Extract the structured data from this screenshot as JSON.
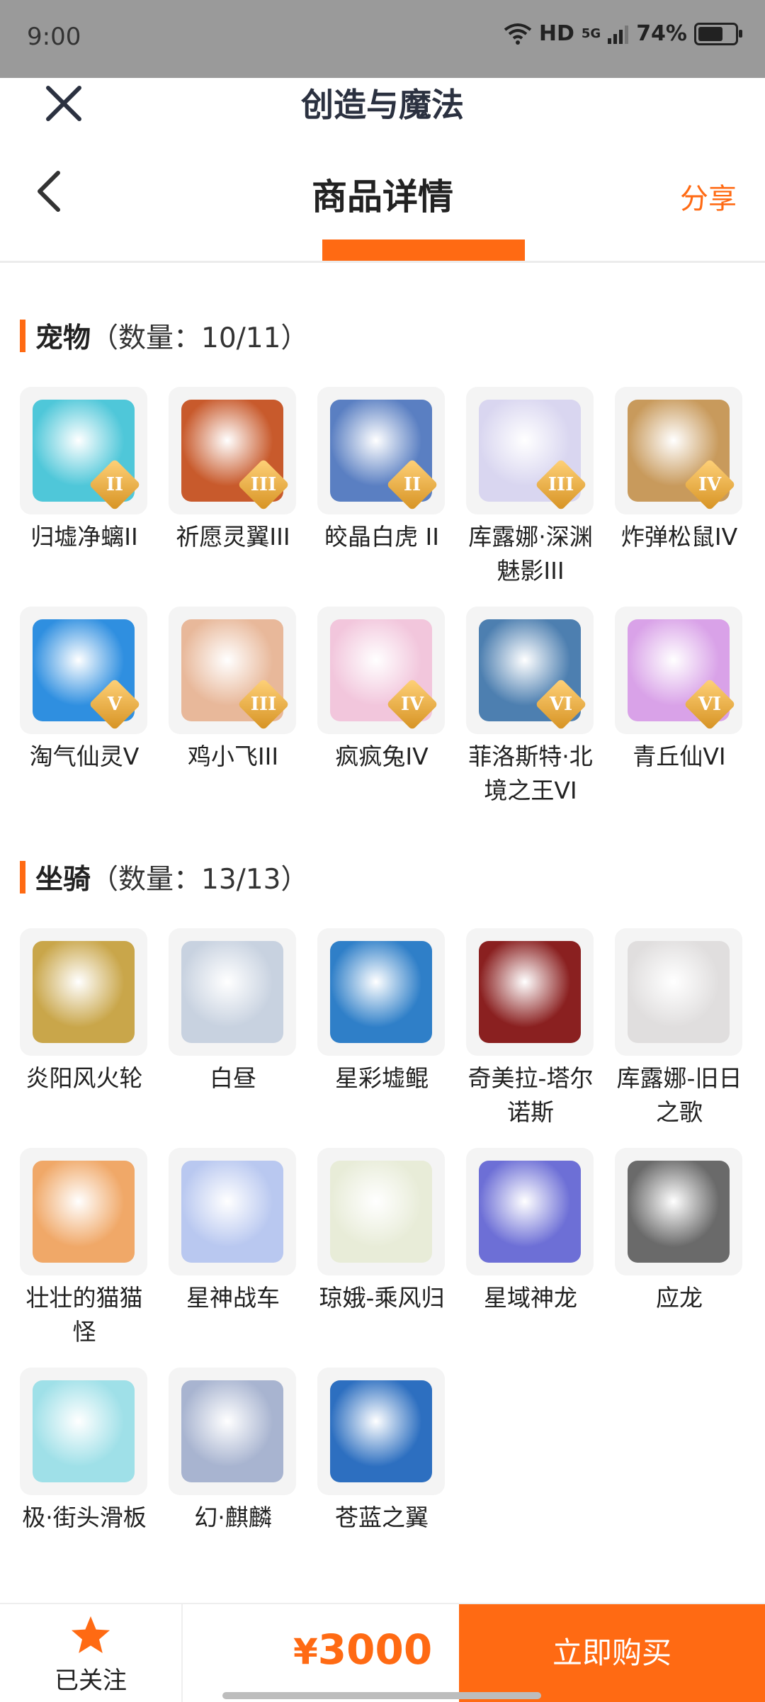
{
  "status": {
    "time": "9:00",
    "network": "HD",
    "signal": "5G",
    "battery": "74%",
    "battery_level": 0.74
  },
  "header": {
    "app_title": "创造与魔法",
    "page_title": "商品详情",
    "share": "分享"
  },
  "pets": {
    "title": "宠物",
    "count": "（数量：10/11）",
    "items": [
      {
        "name": "归墟净螭II",
        "rank": "II",
        "color": "#4fc7d9"
      },
      {
        "name": "祈愿灵翼III",
        "rank": "III",
        "color": "#c85a2c"
      },
      {
        "name": "皎晶白虎 II",
        "rank": "II",
        "color": "#5a7fc2"
      },
      {
        "name": "库露娜·深渊魅影III",
        "rank": "III",
        "color": "#d9d6f0"
      },
      {
        "name": "炸弹松鼠IV",
        "rank": "IV",
        "color": "#c89a5c"
      },
      {
        "name": "淘气仙灵V",
        "rank": "V",
        "color": "#2f8fe0"
      },
      {
        "name": "鸡小飞III",
        "rank": "III",
        "color": "#e8b89a"
      },
      {
        "name": "疯疯兔IV",
        "rank": "IV",
        "color": "#f2c6dc"
      },
      {
        "name": "菲洛斯特·北境之王VI",
        "rank": "VI",
        "color": "#4d7fb0"
      },
      {
        "name": "青丘仙VI",
        "rank": "VI",
        "color": "#d9a2e8"
      }
    ]
  },
  "mounts": {
    "title": "坐骑",
    "count": "（数量：13/13）",
    "items": [
      {
        "name": "炎阳风火轮",
        "color": "#c9a64a"
      },
      {
        "name": "白昼",
        "color": "#c8d2e0"
      },
      {
        "name": "星彩墟鲲",
        "color": "#2f7fc8"
      },
      {
        "name": "奇美拉-塔尔诺斯",
        "color": "#8a2020"
      },
      {
        "name": "库露娜-旧日之歌",
        "color": "#e0dede"
      },
      {
        "name": "壮壮的猫猫怪",
        "color": "#f0a868"
      },
      {
        "name": "星神战车",
        "color": "#b9c8f0"
      },
      {
        "name": "琼娥-乘风归",
        "color": "#e8ecd8"
      },
      {
        "name": "星域神龙",
        "color": "#6d6fd6"
      },
      {
        "name": "应龙",
        "color": "#6a6a6a"
      },
      {
        "name": "极·街头滑板",
        "color": "#9fe0e8"
      },
      {
        "name": "幻·麒麟",
        "color": "#a8b4d0"
      },
      {
        "name": "苍蓝之翼",
        "color": "#2d6fc0"
      }
    ]
  },
  "bottom": {
    "follow": "已关注",
    "price_symbol": "¥",
    "price": "3000",
    "buy": "立即购买"
  },
  "colors": {
    "accent": "#ff6a13"
  }
}
